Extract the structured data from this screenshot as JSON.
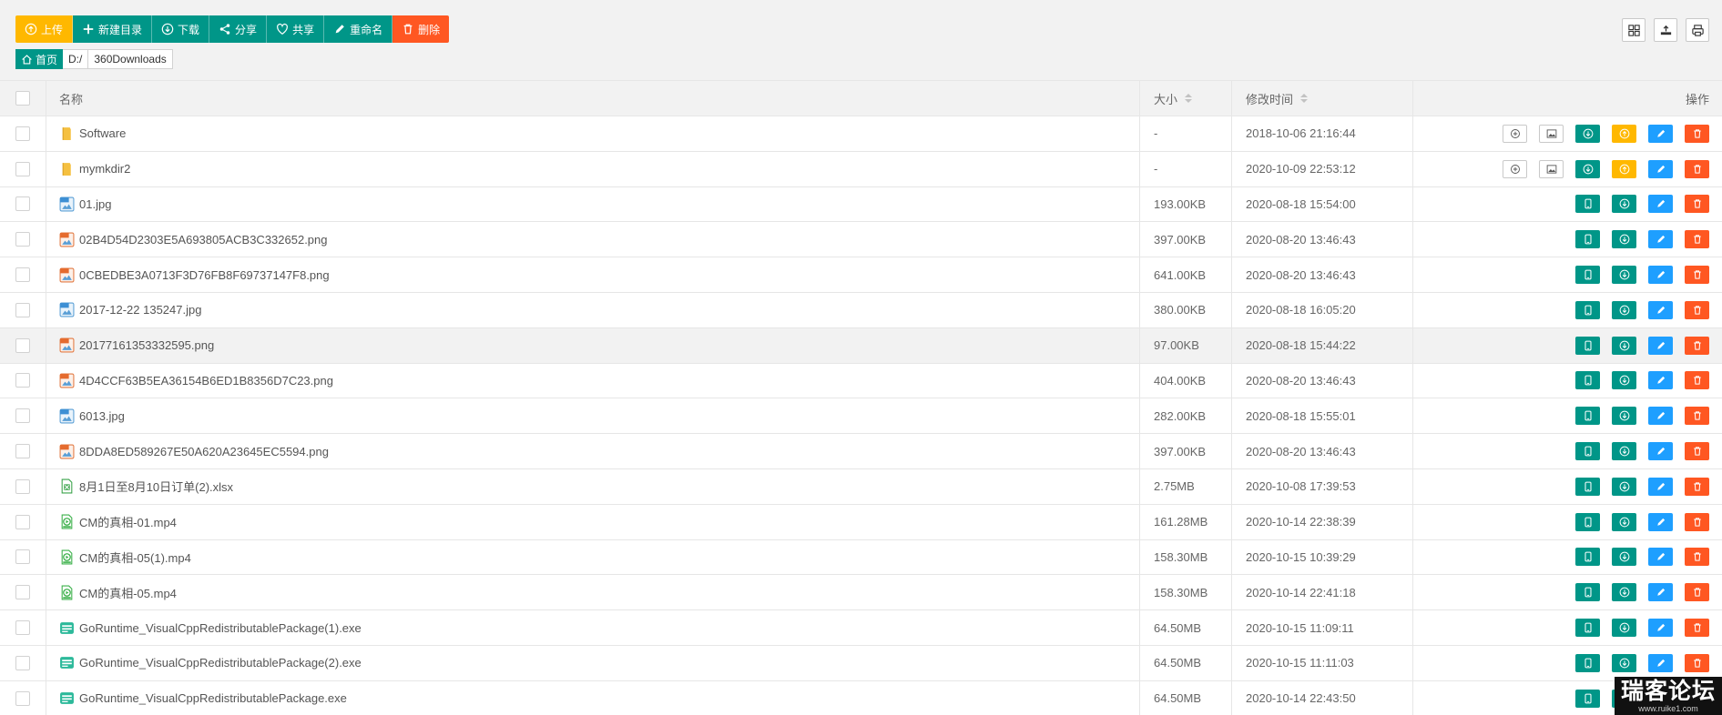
{
  "toolbar": {
    "upload_label": "上传",
    "newdir_label": "新建目录",
    "download_label": "下载",
    "share_label": "分享",
    "cooperate_label": "共享",
    "rename_label": "重命名",
    "delete_label": "删除"
  },
  "breadcrumb": {
    "home_label": "首页",
    "items": [
      "D:/",
      "360Downloads"
    ]
  },
  "table": {
    "headers": {
      "name": "名称",
      "size": "大小",
      "mtime": "修改时间",
      "actions": "操作"
    },
    "rows": [
      {
        "name": "Software",
        "type": "folder",
        "size": "-",
        "mtime": "2018-10-06 21:16:44"
      },
      {
        "name": "mymkdir2",
        "type": "folder",
        "size": "-",
        "mtime": "2020-10-09 22:53:12"
      },
      {
        "name": "01.jpg",
        "type": "jpg",
        "size": "193.00KB",
        "mtime": "2020-08-18 15:54:00"
      },
      {
        "name": "02B4D54D2303E5A693805ACB3C332652.png",
        "type": "png",
        "size": "397.00KB",
        "mtime": "2020-08-20 13:46:43"
      },
      {
        "name": "0CBEDBE3A0713F3D76FB8F69737147F8.png",
        "type": "png",
        "size": "641.00KB",
        "mtime": "2020-08-20 13:46:43"
      },
      {
        "name": "2017-12-22 135247.jpg",
        "type": "jpg",
        "size": "380.00KB",
        "mtime": "2020-08-18 16:05:20"
      },
      {
        "name": "20177161353332595.png",
        "type": "png",
        "size": "97.00KB",
        "mtime": "2020-08-18 15:44:22"
      },
      {
        "name": "4D4CCF63B5EA36154B6ED1B8356D7C23.png",
        "type": "png",
        "size": "404.00KB",
        "mtime": "2020-08-20 13:46:43"
      },
      {
        "name": "6013.jpg",
        "type": "jpg",
        "size": "282.00KB",
        "mtime": "2020-08-18 15:55:01"
      },
      {
        "name": "8DDA8ED589267E50A620A23645EC5594.png",
        "type": "png",
        "size": "397.00KB",
        "mtime": "2020-08-20 13:46:43"
      },
      {
        "name": "8月1日至8月10日订单(2).xlsx",
        "type": "xlsx",
        "size": "2.75MB",
        "mtime": "2020-10-08 17:39:53"
      },
      {
        "name": "CM的真相-01.mp4",
        "type": "mp4",
        "size": "161.28MB",
        "mtime": "2020-10-14 22:38:39"
      },
      {
        "name": "CM的真相-05(1).mp4",
        "type": "mp4",
        "size": "158.30MB",
        "mtime": "2020-10-15 10:39:29"
      },
      {
        "name": "CM的真相-05.mp4",
        "type": "mp4",
        "size": "158.30MB",
        "mtime": "2020-10-14 22:41:18"
      },
      {
        "name": "GoRuntime_VisualCppRedistributablePackage(1).exe",
        "type": "exe",
        "size": "64.50MB",
        "mtime": "2020-10-15 11:09:11"
      },
      {
        "name": "GoRuntime_VisualCppRedistributablePackage(2).exe",
        "type": "exe",
        "size": "64.50MB",
        "mtime": "2020-10-15 11:11:03"
      },
      {
        "name": "GoRuntime_VisualCppRedistributablePackage.exe",
        "type": "exe",
        "size": "64.50MB",
        "mtime": "2020-10-14 22:43:50"
      }
    ]
  },
  "watermark": {
    "main": "瑞客论坛",
    "sub": "www.ruike1.com"
  },
  "colors": {
    "warn": "#ffb800",
    "green": "#009688",
    "red": "#ff5722",
    "blue": "#1e9fff"
  }
}
